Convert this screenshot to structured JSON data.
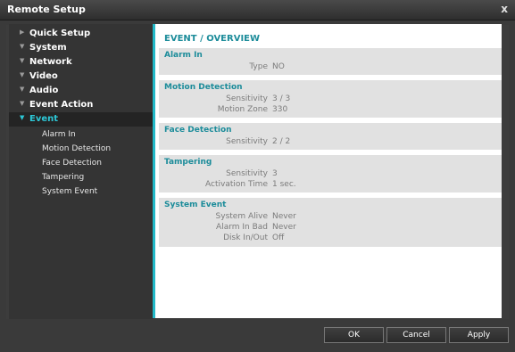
{
  "window": {
    "title": "Remote Setup",
    "close_glyph": "x"
  },
  "nav": {
    "items": [
      {
        "label": "Quick Setup"
      },
      {
        "label": "System"
      },
      {
        "label": "Network"
      },
      {
        "label": "Video"
      },
      {
        "label": "Audio"
      },
      {
        "label": "Event Action"
      },
      {
        "label": "Event"
      }
    ],
    "sub_items": [
      {
        "label": "Alarm In"
      },
      {
        "label": "Motion Detection"
      },
      {
        "label": "Face Detection"
      },
      {
        "label": "Tampering"
      },
      {
        "label": "System Event"
      }
    ]
  },
  "content": {
    "title": "EVENT / OVERVIEW",
    "alarm_in": {
      "title": "Alarm In",
      "type_label": "Type",
      "type_value": "NO"
    },
    "motion": {
      "title": "Motion Detection",
      "sensitivity_label": "Sensitivity",
      "sensitivity_value": "3 / 3",
      "zone_label": "Motion Zone",
      "zone_value": "330"
    },
    "face": {
      "title": "Face Detection",
      "sensitivity_label": "Sensitivity",
      "sensitivity_value": "2 / 2"
    },
    "tampering": {
      "title": "Tampering",
      "sensitivity_label": "Sensitivity",
      "sensitivity_value": "3",
      "activation_label": "Activation Time",
      "activation_value": "1 sec."
    },
    "system_event": {
      "title": "System Event",
      "alive_label": "System Alive",
      "alive_value": "Never",
      "alarm_bad_label": "Alarm In Bad",
      "alarm_bad_value": "Never",
      "disk_label": "Disk In/Out",
      "disk_value": "Off"
    }
  },
  "footer": {
    "ok": "OK",
    "cancel": "Cancel",
    "apply": "Apply"
  },
  "colors": {
    "accent": "#22b9c8",
    "active_text": "#2dc7d6",
    "section_title": "#1c8c9a"
  }
}
